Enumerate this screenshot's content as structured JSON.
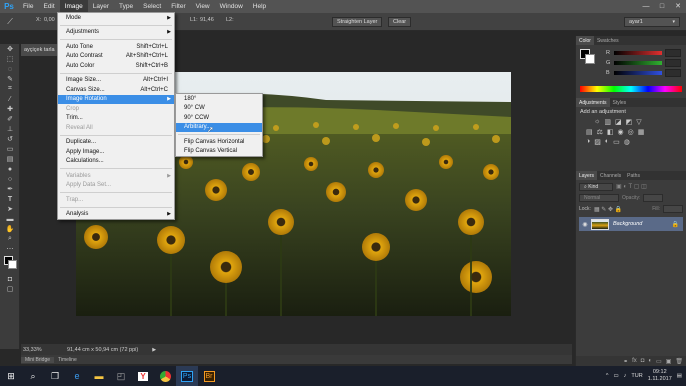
{
  "app": {
    "logo": "Ps"
  },
  "menubar": {
    "items": [
      "File",
      "Edit",
      "Image",
      "Layer",
      "Type",
      "Select",
      "Filter",
      "View",
      "Window",
      "Help"
    ],
    "active_index": 2
  },
  "window_controls": [
    "—",
    "□",
    "✕"
  ],
  "options_bar": {
    "x_label": "X:",
    "x_value": "0,00",
    "l1_label": "L1:",
    "l1_value": "91,46",
    "l2_label": "L2:",
    "straighten_button": "Straighten Layer",
    "clear_button": "Clear",
    "workspace": "ayar1"
  },
  "document": {
    "tab_title": "ayçiçek tarla"
  },
  "status": {
    "zoom": "33,33%",
    "doc_size": "91,44 cm x 50,94 cm (72 ppi)"
  },
  "bottom_tabs": [
    "Mini Bridge",
    "Timeline"
  ],
  "image_menu": {
    "items": [
      {
        "label": "Mode",
        "shortcut": "",
        "submenu": true,
        "disabled": false
      },
      {
        "sep": true
      },
      {
        "label": "Adjustments",
        "shortcut": "",
        "submenu": true,
        "disabled": false
      },
      {
        "sep": true
      },
      {
        "label": "Auto Tone",
        "shortcut": "Shift+Ctrl+L",
        "disabled": false
      },
      {
        "label": "Auto Contrast",
        "shortcut": "Alt+Shift+Ctrl+L",
        "disabled": false
      },
      {
        "label": "Auto Color",
        "shortcut": "Shift+Ctrl+B",
        "disabled": false
      },
      {
        "sep": true
      },
      {
        "label": "Image Size...",
        "shortcut": "Alt+Ctrl+I",
        "disabled": false
      },
      {
        "label": "Canvas Size...",
        "shortcut": "Alt+Ctrl+C",
        "disabled": false
      },
      {
        "label": "Image Rotation",
        "shortcut": "",
        "submenu": true,
        "highlight": true,
        "disabled": false
      },
      {
        "label": "Crop",
        "shortcut": "",
        "disabled": true
      },
      {
        "label": "Trim...",
        "shortcut": "",
        "disabled": false
      },
      {
        "label": "Reveal All",
        "shortcut": "",
        "disabled": true
      },
      {
        "sep": true
      },
      {
        "label": "Duplicate...",
        "shortcut": "",
        "disabled": false
      },
      {
        "label": "Apply Image...",
        "shortcut": "",
        "disabled": false
      },
      {
        "label": "Calculations...",
        "shortcut": "",
        "disabled": false
      },
      {
        "sep": true
      },
      {
        "label": "Variables",
        "shortcut": "",
        "submenu": true,
        "disabled": true
      },
      {
        "label": "Apply Data Set...",
        "shortcut": "",
        "disabled": true
      },
      {
        "sep": true
      },
      {
        "label": "Trap...",
        "shortcut": "",
        "disabled": true
      },
      {
        "sep": true
      },
      {
        "label": "Analysis",
        "shortcut": "",
        "submenu": true,
        "disabled": false
      }
    ]
  },
  "rotation_submenu": {
    "items": [
      {
        "label": "180°"
      },
      {
        "label": "90° CW"
      },
      {
        "label": "90° CCW"
      },
      {
        "label": "Arbitrary...",
        "highlight": true
      },
      {
        "sep": true
      },
      {
        "label": "Flip Canvas Horizontal"
      },
      {
        "label": "Flip Canvas Vertical"
      }
    ]
  },
  "color_panel": {
    "tabs": [
      "Color",
      "Swatches"
    ],
    "channels": [
      {
        "label": "R",
        "color": "#e03030"
      },
      {
        "label": "G",
        "color": "#30b030"
      },
      {
        "label": "B",
        "color": "#3050e0"
      }
    ]
  },
  "adjustments_panel": {
    "tabs": [
      "Adjustments",
      "Styles"
    ],
    "heading": "Add an adjustment"
  },
  "layers_panel": {
    "tabs": [
      "Layers",
      "Channels",
      "Paths"
    ],
    "kind_label": "Kind",
    "blend_mode": "Normal",
    "opacity_label": "Opacity:",
    "lock_label": "Lock:",
    "fill_label": "Fill:",
    "layer_name": "Background"
  },
  "taskbar": {
    "time": "09:12",
    "date": "1.11.2017",
    "lang": "TUR"
  }
}
